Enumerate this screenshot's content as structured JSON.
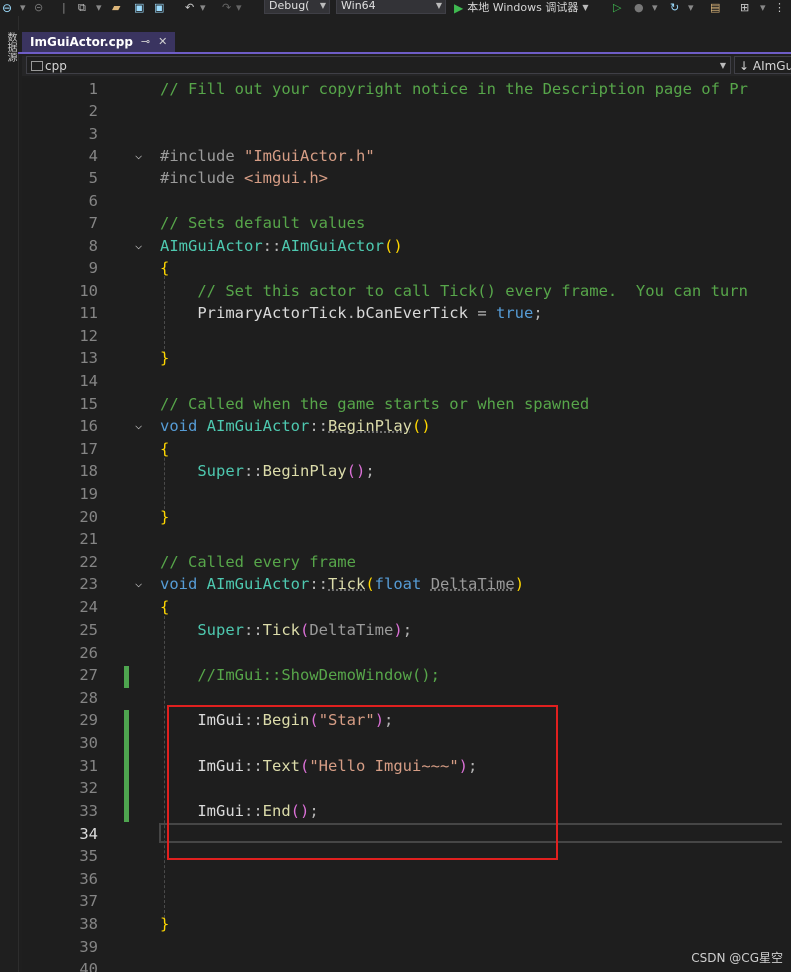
{
  "toolbar": {
    "config_select": "Debug(",
    "platform_select": "Win64",
    "run_label": "本地 Windows 调试器"
  },
  "side_panel": {
    "label": "数据源"
  },
  "tab": {
    "filename": "ImGuiActor.cpp",
    "pin": "⊸",
    "close": "✕"
  },
  "navbar": {
    "scope": "cpp",
    "member": "↓ AImGu"
  },
  "editor": {
    "lines": [
      {
        "n": "1",
        "code": "// Fill out your copyright notice in the Description page of Pr"
      },
      {
        "n": "2",
        "code": ""
      },
      {
        "n": "3",
        "code": ""
      },
      {
        "n": "4",
        "code": "#include \"ImGuiActor.h\""
      },
      {
        "n": "5",
        "code": "#include <imgui.h>"
      },
      {
        "n": "6",
        "code": ""
      },
      {
        "n": "7",
        "code": "// Sets default values"
      },
      {
        "n": "8",
        "code": "AImGuiActor::AImGuiActor()"
      },
      {
        "n": "9",
        "code": "{"
      },
      {
        "n": "10",
        "code": "    // Set this actor to call Tick() every frame.  You can turn"
      },
      {
        "n": "11",
        "code": "    PrimaryActorTick.bCanEverTick = true;"
      },
      {
        "n": "12",
        "code": ""
      },
      {
        "n": "13",
        "code": "}"
      },
      {
        "n": "14",
        "code": ""
      },
      {
        "n": "15",
        "code": "// Called when the game starts or when spawned"
      },
      {
        "n": "16",
        "code": "void AImGuiActor::BeginPlay()"
      },
      {
        "n": "17",
        "code": "{"
      },
      {
        "n": "18",
        "code": "    Super::BeginPlay();"
      },
      {
        "n": "19",
        "code": ""
      },
      {
        "n": "20",
        "code": "}"
      },
      {
        "n": "21",
        "code": ""
      },
      {
        "n": "22",
        "code": "// Called every frame"
      },
      {
        "n": "23",
        "code": "void AImGuiActor::Tick(float DeltaTime)"
      },
      {
        "n": "24",
        "code": "{"
      },
      {
        "n": "25",
        "code": "    Super::Tick(DeltaTime);"
      },
      {
        "n": "26",
        "code": ""
      },
      {
        "n": "27",
        "code": "    //ImGui::ShowDemoWindow();"
      },
      {
        "n": "28",
        "code": ""
      },
      {
        "n": "29",
        "code": "    ImGui::Begin(\"Star\");"
      },
      {
        "n": "30",
        "code": ""
      },
      {
        "n": "31",
        "code": "    ImGui::Text(\"Hello Imgui~~~\");"
      },
      {
        "n": "32",
        "code": ""
      },
      {
        "n": "33",
        "code": "    ImGui::End();"
      },
      {
        "n": "34",
        "code": ""
      },
      {
        "n": "35",
        "code": ""
      },
      {
        "n": "36",
        "code": ""
      },
      {
        "n": "37",
        "code": ""
      },
      {
        "n": "38",
        "code": "}"
      },
      {
        "n": "39",
        "code": ""
      },
      {
        "n": "40",
        "code": ""
      }
    ]
  },
  "watermark": "CSDN @CG星空"
}
